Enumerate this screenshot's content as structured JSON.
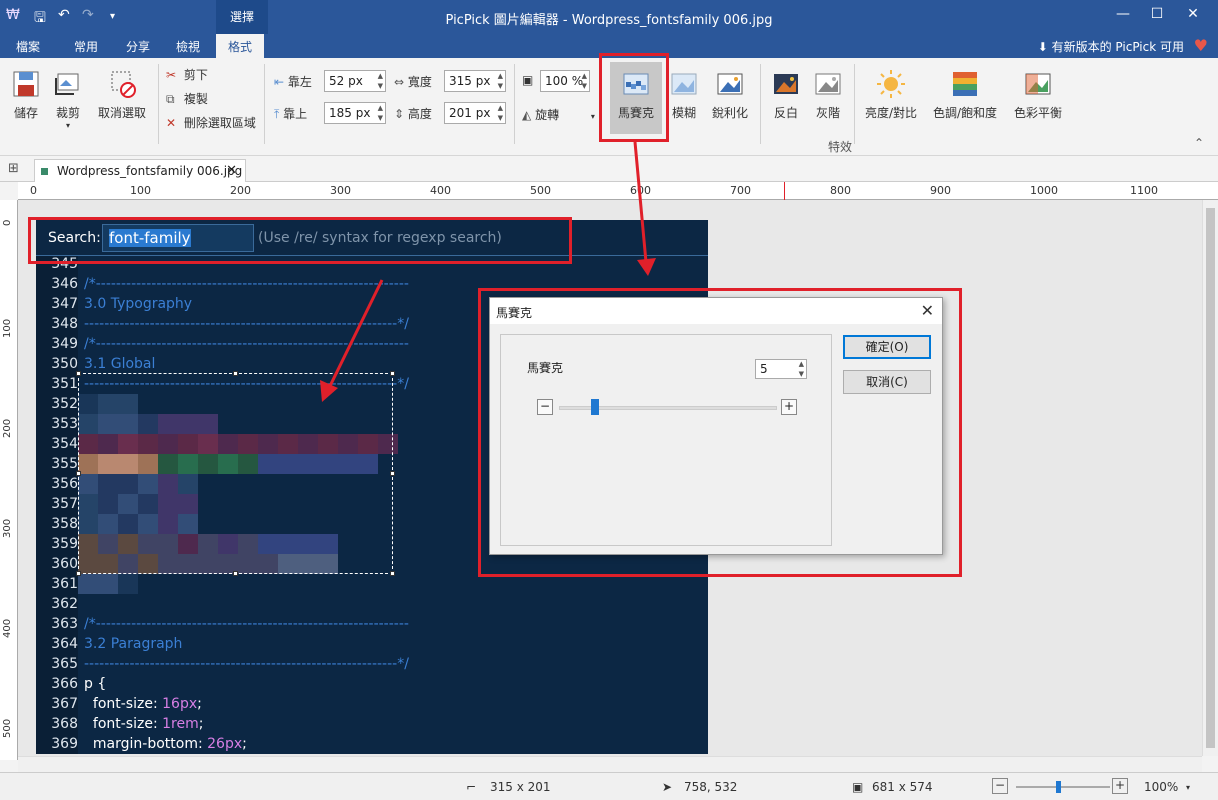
{
  "titlebar": {
    "title": "PicPick 圖片編輯器 - Wordpress_fontsfamily 006.jpg",
    "context_tab": "選擇",
    "qa_icons": [
      "app-icon",
      "save-icon",
      "undo-icon",
      "redo-icon",
      "customize-icon"
    ]
  },
  "menu": {
    "tabs": [
      "檔案",
      "常用",
      "分享",
      "檢視",
      "格式"
    ],
    "active_tab": "格式",
    "update_notice": "有新版本的 PicPick 可用"
  },
  "ribbon": {
    "save": "儲存",
    "crop": "裁剪",
    "deselect": "取消選取",
    "cut": "剪下",
    "copy": "複製",
    "delete_selection": "刪除選取區域",
    "left_label": "靠左",
    "left_value": "52 px",
    "top_label": "靠上",
    "top_value": "185 px",
    "width_label": "寬度",
    "width_value": "315 px",
    "height_label": "高度",
    "height_value": "201 px",
    "zoom_value": "100 %",
    "rotate": "旋轉",
    "effects": [
      "馬賽克",
      "模糊",
      "銳利化",
      "反白",
      "灰階",
      "亮度/對比",
      "色調/飽和度",
      "色彩平衡"
    ],
    "active_effect": "馬賽克",
    "effects_group": "特效"
  },
  "document": {
    "tab_name": "Wordpress_fontsfamily 006.jpg"
  },
  "rulers": {
    "top": [
      "0",
      "100",
      "200",
      "300",
      "400",
      "500",
      "600",
      "700",
      "800",
      "900",
      "1000",
      "1100"
    ],
    "left": [
      "0",
      "100",
      "200",
      "300",
      "400",
      "500"
    ]
  },
  "image": {
    "search_label": "Search:",
    "search_value": "font-family",
    "search_hint": "(Use /re/ syntax for regexp search)",
    "lines": [
      {
        "n": "345",
        "t": "",
        "c": "c-tx"
      },
      {
        "n": "346",
        "t": "/*--------------------------------------------------------------",
        "c": "c-cm"
      },
      {
        "n": "347",
        "t": "3.0 Typography",
        "c": "c-cm"
      },
      {
        "n": "348",
        "t": "--------------------------------------------------------------*/",
        "c": "c-cm"
      },
      {
        "n": "349",
        "t": "/*--------------------------------------------------------------",
        "c": "c-cm"
      },
      {
        "n": "350",
        "t": "3.1 Global",
        "c": "c-cm"
      },
      {
        "n": "351",
        "t": "--------------------------------------------------------------*/",
        "c": "c-cm"
      },
      {
        "n": "352",
        "t": "",
        "c": "c-tx"
      },
      {
        "n": "353",
        "t": "",
        "c": "c-tx"
      },
      {
        "n": "354",
        "t": "",
        "c": "c-tx"
      },
      {
        "n": "355",
        "t": "",
        "c": "c-tx"
      },
      {
        "n": "356",
        "t": "",
        "c": "c-tx"
      },
      {
        "n": "357",
        "t": "",
        "c": "c-tx"
      },
      {
        "n": "358",
        "t": "",
        "c": "c-tx"
      },
      {
        "n": "359",
        "t": "",
        "c": "c-tx"
      },
      {
        "n": "360",
        "t": "",
        "c": "c-tx"
      },
      {
        "n": "361",
        "t": "",
        "c": "c-tx"
      },
      {
        "n": "362",
        "t": "",
        "c": "c-tx"
      },
      {
        "n": "363",
        "t": "/*--------------------------------------------------------------",
        "c": "c-cm"
      },
      {
        "n": "364",
        "t": "3.2 Paragraph",
        "c": "c-cm"
      },
      {
        "n": "365",
        "t": "--------------------------------------------------------------*/",
        "c": "c-cm"
      },
      {
        "n": "366",
        "t": "p {",
        "c": "c-tx"
      },
      {
        "n": "367",
        "t": "  font-size: ",
        "c": "c-tx",
        "num": "16px",
        "end": ";"
      },
      {
        "n": "368",
        "t": "  font-size: ",
        "c": "c-tx",
        "num": "1rem",
        "end": ";"
      },
      {
        "n": "369",
        "t": "  margin-bottom: ",
        "c": "c-tx",
        "num": "26px",
        "end": ";"
      }
    ]
  },
  "dialog": {
    "title": "馬賽克",
    "label": "馬賽克",
    "value": "5",
    "slider_fraction": 0.15,
    "ok": "確定(O)",
    "cancel": "取消(C)",
    "minus": "−",
    "plus": "+"
  },
  "statusbar": {
    "selection_size": "315 x 201",
    "cursor_pos": "758, 532",
    "image_size": "681 x 574",
    "zoom": "100%"
  },
  "colors": {
    "accent": "#2b579a",
    "annotation": "#e0202a",
    "code_bg": "#0c2744",
    "comment": "#3b7fd4",
    "number": "#d77fe4"
  }
}
